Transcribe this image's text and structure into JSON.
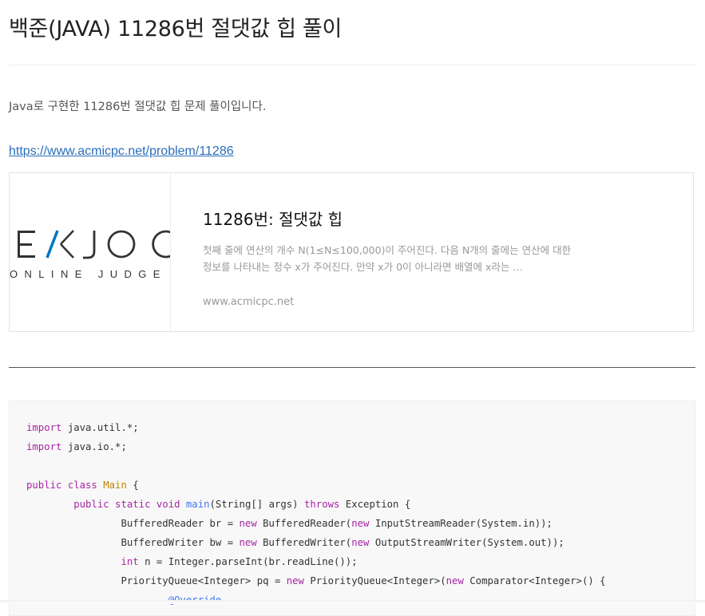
{
  "post": {
    "title": "백준(JAVA) 11286번 절댓값 힙 풀이",
    "intro": "Java로 구현한 11286번 절댓값 힙 문제 풀이입니다.",
    "link": "https://www.acmicpc.net/problem/11286"
  },
  "og_card": {
    "thumb_logo_text": "EKJOC",
    "thumb_sub_text": "ONLINE JUDGE",
    "title": "11286번: 절댓값 힙",
    "description": "첫째 줄에 연산의 개수 N(1≤N≤100,000)이 주어진다. 다음 N개의 줄에는 연산에 대한 정보를 나타내는 정수 x가 주어진다. 만약 x가 0이 아니라면 배열에 x라는 …",
    "site": "www.acmicpc.net",
    "accent_color": "#0076c0"
  },
  "code": {
    "lines": [
      [
        {
          "t": "import",
          "c": "kw"
        },
        {
          "t": " java.util.*;",
          "c": ""
        }
      ],
      [
        {
          "t": "import",
          "c": "kw"
        },
        {
          "t": " java.io.*;",
          "c": ""
        }
      ],
      [],
      [
        {
          "t": "public class ",
          "c": "kw"
        },
        {
          "t": "Main",
          "c": "cls"
        },
        {
          "t": " {",
          "c": ""
        }
      ],
      [
        {
          "t": "        ",
          "c": ""
        },
        {
          "t": "public static void ",
          "c": "kw"
        },
        {
          "t": "main",
          "c": "fn"
        },
        {
          "t": "(String[] args) ",
          "c": ""
        },
        {
          "t": "throws",
          "c": "kw"
        },
        {
          "t": " Exception {",
          "c": ""
        }
      ],
      [
        {
          "t": "                BufferedReader br = ",
          "c": ""
        },
        {
          "t": "new",
          "c": "kw"
        },
        {
          "t": " BufferedReader(",
          "c": ""
        },
        {
          "t": "new",
          "c": "kw"
        },
        {
          "t": " InputStreamReader(System.in));",
          "c": ""
        }
      ],
      [
        {
          "t": "                BufferedWriter bw = ",
          "c": ""
        },
        {
          "t": "new",
          "c": "kw"
        },
        {
          "t": " BufferedWriter(",
          "c": ""
        },
        {
          "t": "new",
          "c": "kw"
        },
        {
          "t": " OutputStreamWriter(System.out));",
          "c": ""
        }
      ],
      [
        {
          "t": "                ",
          "c": ""
        },
        {
          "t": "int",
          "c": "kw"
        },
        {
          "t": " n = Integer.parseInt(br.readLine());",
          "c": ""
        }
      ],
      [
        {
          "t": "                PriorityQueue<Integer> pq = ",
          "c": ""
        },
        {
          "t": "new",
          "c": "kw"
        },
        {
          "t": " PriorityQueue<Integer>(",
          "c": ""
        },
        {
          "t": "new",
          "c": "kw"
        },
        {
          "t": " Comparator<Integer>() {",
          "c": ""
        }
      ],
      [
        {
          "t": "                        ",
          "c": ""
        },
        {
          "t": "@Override",
          "c": "ann"
        }
      ]
    ]
  }
}
